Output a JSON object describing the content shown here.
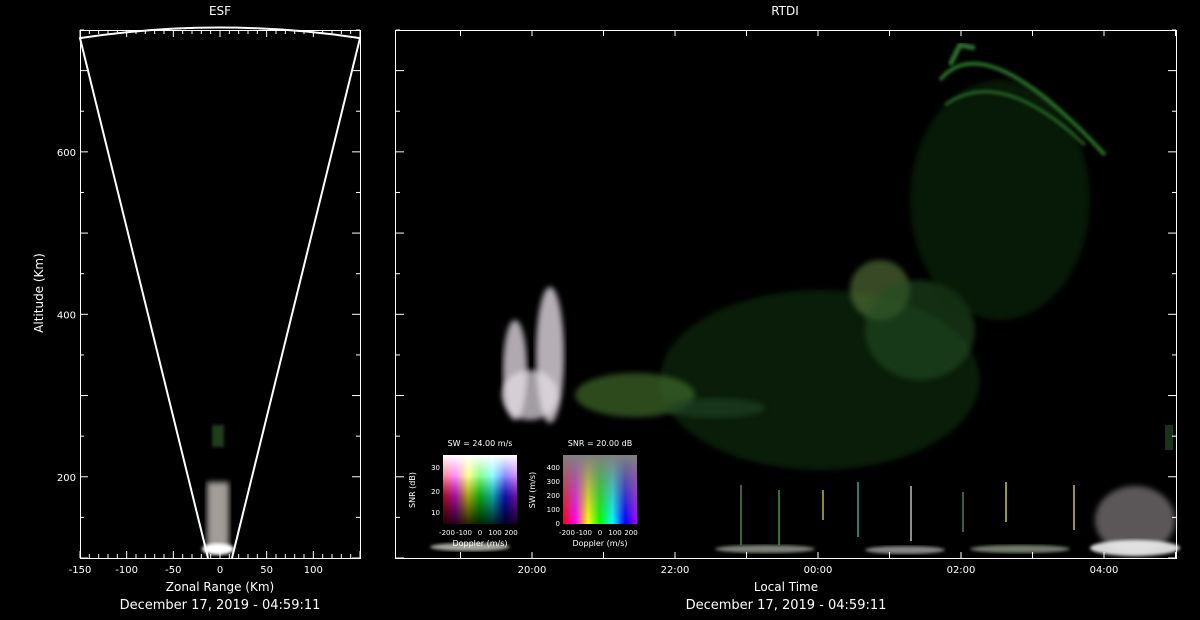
{
  "chart_data": [
    {
      "type": "heatmap",
      "title": "ESF",
      "xlabel": "Zonal Range (Km)",
      "ylabel": "Altitude (Km)",
      "xlim": [
        -150,
        150
      ],
      "ylim": [
        100,
        750
      ],
      "xticks": [
        -150,
        -100,
        -50,
        0,
        50,
        100
      ],
      "yticks": [
        200,
        400,
        600
      ],
      "footer": "December 17, 2019 - 04:59:11",
      "radar_sector": {
        "apex_range": 0,
        "apex_altitude": 100,
        "edge_ranges": [
          -150,
          150
        ],
        "edge_altitude": 740,
        "max_altitude": 750
      },
      "echoes": [
        {
          "range": 0,
          "altitude_min": 100,
          "altitude_max": 195,
          "color": "#e0d8d0"
        },
        {
          "range": 0,
          "altitude_min": 240,
          "altitude_max": 270,
          "color": "#2a5a2a"
        }
      ]
    },
    {
      "type": "heatmap",
      "title": "RTDI",
      "xlabel": "Local Time",
      "ylabel": "",
      "xticks": [
        "20:00",
        "22:00",
        "00:00",
        "02:00",
        "04:00"
      ],
      "footer": "December 17, 2019 - 04:59:11",
      "echoes": [
        {
          "time": "19:55",
          "altitude_min": 280,
          "altitude_max": 410,
          "color": "#d8d0d8"
        },
        {
          "time": "20:15",
          "altitude_min": 280,
          "altitude_max": 450,
          "color": "#d8d0d8"
        },
        {
          "time": "21:00",
          "altitude_min": 290,
          "altitude_max": 340,
          "color": "#4a7a30"
        },
        {
          "time": "00:30",
          "altitude_min": 300,
          "altitude_max": 480,
          "color": "#4a6a30"
        },
        {
          "time": "01:30",
          "altitude_min": 400,
          "altitude_max": 740,
          "color": "#2f6a2f"
        },
        {
          "time": "04:30",
          "altitude_min": 100,
          "altitude_max": 190,
          "color": "#c0b8b0"
        }
      ]
    }
  ],
  "legends": {
    "sw": {
      "title": "SW = 24.00 m/s",
      "ylabel": "SNR (dB)",
      "yticks": [
        "30",
        "20",
        "10"
      ],
      "xlabel": "Doppler (m/s)",
      "xticks": [
        "-200",
        "-100",
        "0",
        "100",
        "200"
      ]
    },
    "snr": {
      "title": "SNR = 20.00 dB",
      "ylabel": "SW (m/s)",
      "yticks": [
        "400",
        "300",
        "200",
        "100",
        "0"
      ],
      "xlabel": "Doppler (m/s)",
      "xticks": [
        "-200",
        "-100",
        "0",
        "100",
        "200"
      ]
    }
  }
}
